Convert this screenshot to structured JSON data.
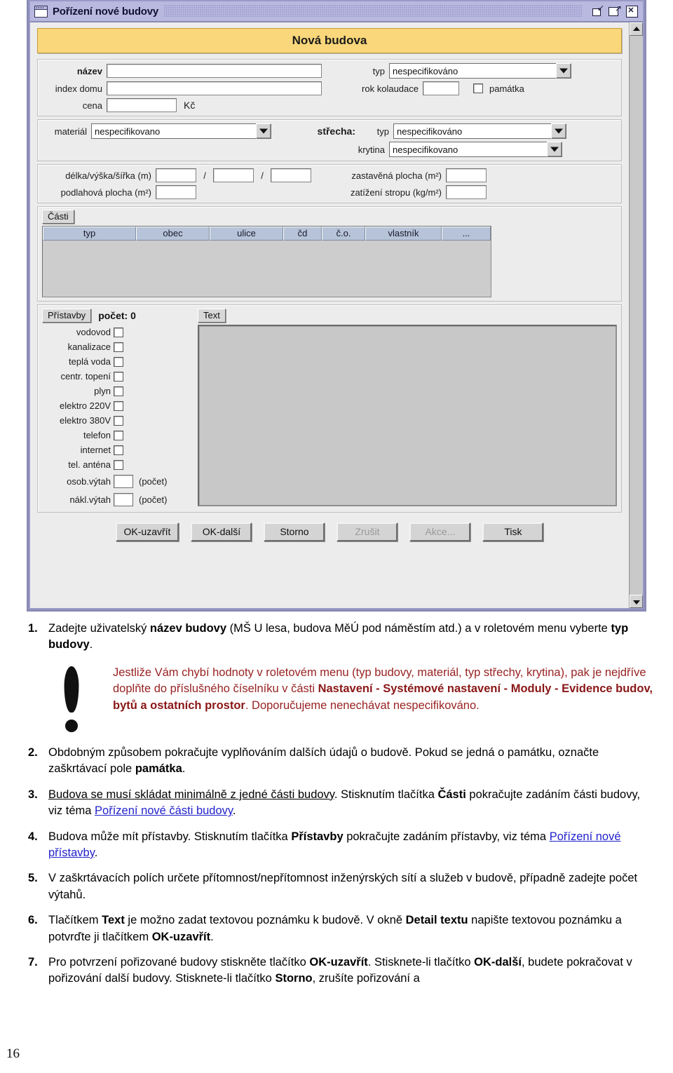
{
  "window": {
    "title": "Pořízení nové budovy",
    "controls": {
      "minimize": "minimize-icon",
      "maximize": "maximize-icon",
      "close": "close-icon"
    }
  },
  "dialog": {
    "banner": "Nová budova",
    "fields": {
      "nazev_label": "název",
      "nazev_value": "",
      "index_domu_label": "index domu",
      "index_domu_value": "",
      "cena_label": "cena",
      "cena_value": "",
      "cena_unit": "Kč",
      "typ_label": "typ",
      "typ_value": "nespecifikováno",
      "rok_kolaudace_label": "rok kolaudace",
      "rok_kolaudace_value": "",
      "pamatka_label": "památka",
      "pamatka_checked": false
    },
    "materials": {
      "material_label": "materiál",
      "material_value": "nespecifikovano",
      "strecha_label": "střecha:",
      "strecha_typ_label": "typ",
      "strecha_typ_value": "nespecifikováno",
      "krytina_label": "krytina",
      "krytina_value": "nespecifikovano"
    },
    "dimensions": {
      "dvs_label": "délka/výška/šířka (m)",
      "dvs_sep1": "/",
      "dvs_sep2": "/",
      "delka": "",
      "vyska": "",
      "sirka": "",
      "zastavena_label": "zastavěná plocha (m²)",
      "zastavena_value": "",
      "podlahova_label": "podlahová plocha (m²)",
      "podlahova_value": "",
      "zatizeni_label": "zatížení stropu (kg/m²)",
      "zatizeni_value": ""
    },
    "parts": {
      "button": "Části",
      "columns": [
        "typ",
        "obec",
        "ulice",
        "čd",
        "č.o.",
        "vlastník",
        "..."
      ],
      "rows": []
    },
    "utilities": {
      "button": "Přístavby",
      "count_label": "počet: 0",
      "text_button": "Text",
      "items": [
        {
          "label": "vodovod",
          "checked": false
        },
        {
          "label": "kanalizace",
          "checked": false
        },
        {
          "label": "teplá voda",
          "checked": false
        },
        {
          "label": "centr. topení",
          "checked": false
        },
        {
          "label": "plyn",
          "checked": false
        },
        {
          "label": "elektro 220V",
          "checked": false
        },
        {
          "label": "elektro 380V",
          "checked": false
        },
        {
          "label": "telefon",
          "checked": false
        },
        {
          "label": "internet",
          "checked": false
        },
        {
          "label": "tel. anténa",
          "checked": false
        }
      ],
      "lifts": [
        {
          "label": "osob.výtah",
          "value": "",
          "hint": "(počet)"
        },
        {
          "label": "nákl.výtah",
          "value": "",
          "hint": "(počet)"
        }
      ]
    },
    "buttons": [
      {
        "label": "OK-uzavřít",
        "disabled": false
      },
      {
        "label": "OK-další",
        "disabled": false
      },
      {
        "label": "Storno",
        "disabled": false
      },
      {
        "label": "Zrušit",
        "disabled": true
      },
      {
        "label": "Akce...",
        "disabled": true
      },
      {
        "label": "Tisk",
        "disabled": false
      }
    ]
  },
  "doc": {
    "page_number": "16",
    "callout": {
      "line1_a": "Jestliže Vám chybí hodnoty v roletovém menu (typ budovy, materiál, typ střechy, krytina), pak je nejdříve doplňte do příslušného číselníku v části ",
      "line1_b": "Nastavení - Systémové nastavení - Moduly - Evidence budov, bytů a ostatních prostor",
      "line1_c": ". Doporučujeme nenechávat nespecifikováno."
    },
    "steps": [
      {
        "num": "1.",
        "p1": "Zadejte uživatelský ",
        "b1": "název budovy",
        "p2": " (MŠ U lesa, budova MěÚ pod náměstím atd.) a v roletovém menu vyberte ",
        "b2": "typ budovy",
        "p3": "."
      },
      {
        "num": "2.",
        "p1": "Obdobným způsobem pokračujte vyplňováním dalších údajů o budově. Pokud se jedná o památku, označte zaškrtávací pole ",
        "b1": "památka",
        "p2": "."
      },
      {
        "num": "3.",
        "u1": "Budova se musí skládat minimálně z jedné části budovy",
        "p1": ". Stisknutím tlačítka ",
        "b1": "Části",
        "p2": " pokračujte zadáním části budovy, viz téma ",
        "link": "Pořízení nové části budovy",
        "p3": "."
      },
      {
        "num": "4.",
        "p1": "Budova může mít přístavby. Stisknutím tlačítka ",
        "b1": "Přístavby",
        "p2": " pokračujte zadáním přístavby, viz téma ",
        "link": "Pořízení nové přístavby",
        "p3": "."
      },
      {
        "num": "5.",
        "p1": "V zaškrtávacích polích určete přítomnost/nepřítomnost inženýrských sítí a služeb v budově, případně zadejte počet výtahů."
      },
      {
        "num": "6.",
        "p1": "Tlačítkem ",
        "b1": "Text",
        "p2": " je možno zadat textovou poznámku k budově. V okně ",
        "b2": "Detail textu",
        "p3": " napište textovou poznámku a potvrďte ji tlačítkem ",
        "b3": "OK-uzavřít",
        "p4": "."
      },
      {
        "num": "7.",
        "p1": "Pro potvrzení pořizované budovy stiskněte tlačítko ",
        "b1": "OK-uzavřít",
        "p2": ". Stisknete-li tlačítko ",
        "b2": "OK-další",
        "p3": ", budete pokračovat v pořizování další budovy. Stisknete-li tlačítko ",
        "b3": "Storno",
        "p4": ", zrušíte pořizování a"
      }
    ]
  }
}
